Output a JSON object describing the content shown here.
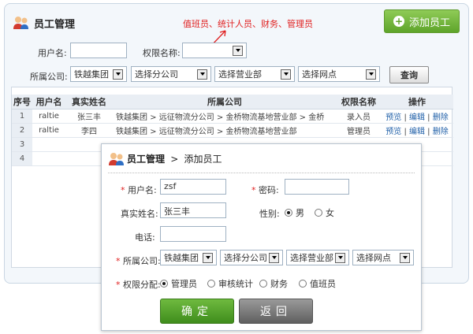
{
  "header": {
    "title": "员工管理",
    "annotation": "值班员、统计人员、财务、管理员",
    "add_button": "添加员工"
  },
  "filters": {
    "username_label": "用户名:",
    "username_value": "",
    "perm_label": "权限名称:",
    "perm_value": "",
    "company_label": "所属公司:",
    "company_value": "铁越集团",
    "branch_value": "选择分公司",
    "dept_value": "选择营业部",
    "outlet_value": "选择网点",
    "query_button": "查询"
  },
  "table": {
    "headers": [
      "序号",
      "用户名",
      "真实姓名",
      "所属公司",
      "权限名称",
      "操作"
    ],
    "rows": [
      {
        "idx": "1",
        "user": "raltie",
        "name": "张三丰",
        "company": "铁越集团 > 远征物流分公司 > 金桥物流基地营业部 > 金桥",
        "perm": "录入员",
        "ops": [
          "预览",
          "编辑",
          "删除"
        ]
      },
      {
        "idx": "2",
        "user": "raltie",
        "name": "李四",
        "company": "铁越集团 > 远征物流分公司 > 金桥物流基地营业部",
        "perm": "管理员",
        "ops": [
          "预览",
          "编辑",
          "删除"
        ]
      }
    ],
    "empty_idx": [
      "3",
      "4"
    ]
  },
  "dialog": {
    "title_main": "员工管理",
    "title_sep": ">",
    "title_sub": "添加员工",
    "username_label": "用户名:",
    "username_value": "zsf",
    "password_label": "密码:",
    "password_value": "",
    "realname_label": "真实姓名:",
    "realname_value": "张三丰",
    "gender_label": "性别:",
    "gender_male": "男",
    "gender_female": "女",
    "phone_label": "电话:",
    "phone_value": "",
    "company_label": "所属公司:",
    "company_value": "铁越集团",
    "branch_value": "选择分公司",
    "dept_value": "选择营业部",
    "outlet_value": "选择网点",
    "perm_label": "权限分配:",
    "perm_options": [
      "管理员",
      "审核统计",
      "财务",
      "值班员"
    ],
    "ok_button": "确定",
    "back_button": "返回"
  },
  "colors": {
    "accent_green": "#5ea42a",
    "link_blue": "#1f5fa8",
    "required_red": "#e02020"
  }
}
